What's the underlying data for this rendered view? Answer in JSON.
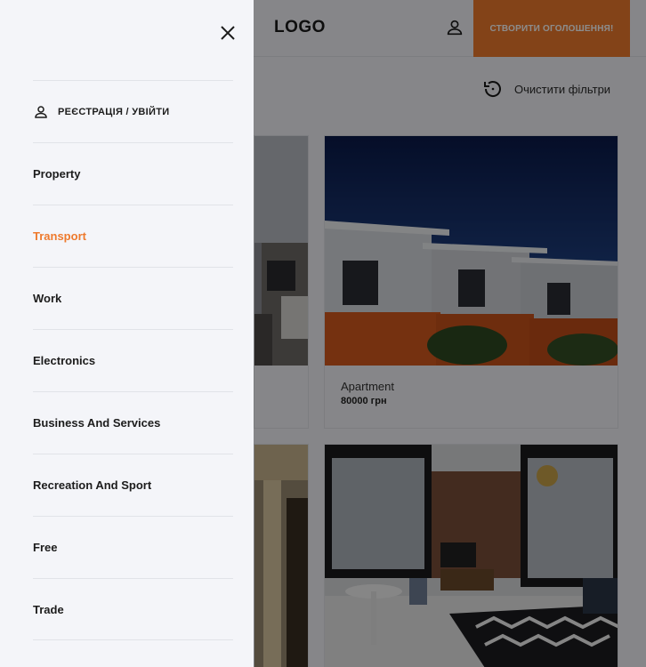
{
  "header": {
    "logo": "LOGO",
    "create_button": "СТВОРИТИ ОГОЛОШЕННЯ!",
    "user_icon": "user-icon",
    "accent_color": "#ee7a2d"
  },
  "filters": {
    "clear_label": "Очистити фільтри",
    "clear_icon": "refresh-icon"
  },
  "listings": [
    {
      "title": "",
      "price": ""
    },
    {
      "title": "Apartment",
      "price": "80000 грн"
    },
    {
      "title": "",
      "price": ""
    },
    {
      "title": "",
      "price": ""
    }
  ],
  "drawer": {
    "close_icon": "close-icon",
    "login_label": "РЕЄСТРАЦІЯ / УВІЙТИ",
    "login_icon": "user-icon",
    "active_item": "Transport",
    "items": [
      {
        "label": "Property"
      },
      {
        "label": "Transport"
      },
      {
        "label": "Work"
      },
      {
        "label": "Electronics"
      },
      {
        "label": "Business And Services"
      },
      {
        "label": "Recreation And Sport"
      },
      {
        "label": "Free"
      },
      {
        "label": "Trade"
      }
    ]
  }
}
